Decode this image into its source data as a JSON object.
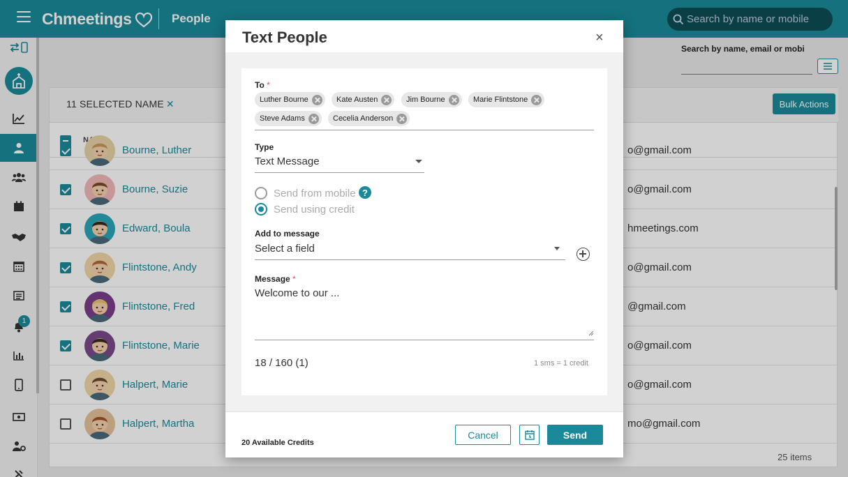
{
  "app": {
    "logo": "Chmeetings",
    "page_title": "People"
  },
  "search": {
    "placeholder": "Search by name or mobile"
  },
  "filter": {
    "label": "Search by name, email or mobi"
  },
  "list": {
    "selected_text": "11 SELECTED NAME",
    "bulk_actions": "Bulk Actions",
    "column_name": "NAME",
    "items_count": "25 items",
    "rows": [
      {
        "name": "Bourne, Luther",
        "email": "o@gmail.com",
        "checked": true
      },
      {
        "name": "Bourne, Suzie",
        "email": "o@gmail.com",
        "checked": true
      },
      {
        "name": "Edward, Boula",
        "email": "hmeetings.com",
        "checked": true
      },
      {
        "name": "Flintstone, Andy",
        "email": "o@gmail.com",
        "checked": true
      },
      {
        "name": "Flintstone, Fred",
        "email": "@gmail.com",
        "checked": true
      },
      {
        "name": "Flintstone, Marie",
        "email": "o@gmail.com",
        "checked": true
      },
      {
        "name": "Halpert, Marie",
        "email": "o@gmail.com",
        "checked": false
      },
      {
        "name": "Halpert, Martha",
        "email": "mo@gmail.com",
        "checked": false
      }
    ]
  },
  "sidebar": {
    "notification_badge": "1"
  },
  "modal": {
    "title": "Text People",
    "close": "×",
    "to_label": "To",
    "required_mark": "*",
    "recipients": [
      "Luther Bourne",
      "Kate Austen",
      "Jim Bourne",
      "Marie Flintstone",
      "Steve Adams",
      "Cecelia Anderson"
    ],
    "type_label": "Type",
    "type_value": "Text Message",
    "send_from_mobile": "Send from mobile",
    "send_using_credit": "Send using credit",
    "help": "?",
    "add_label": "Add to message",
    "add_placeholder": "Select a field",
    "message_label": "Message",
    "message_value": "Welcome to our ...",
    "counter": "18 / 160 (1)",
    "credit_note": "1 sms = 1 credit",
    "available_credits": "20 Available Credits",
    "cancel": "Cancel",
    "send": "Send"
  },
  "colors": {
    "accent": "#1a8a9a",
    "dark_search": "#0d4d56"
  }
}
